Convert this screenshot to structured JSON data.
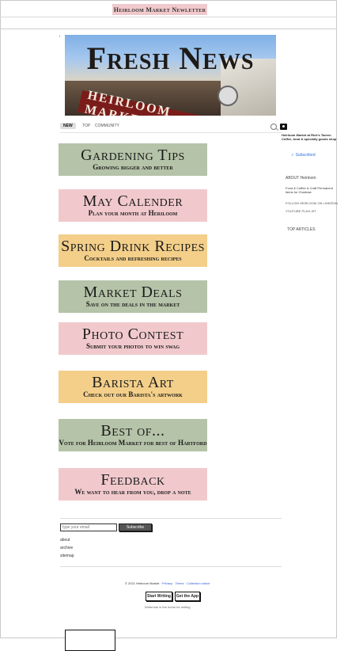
{
  "header": {
    "site_title": "Heirloom Market Newletter"
  },
  "hero": {
    "headline": "Fresh News",
    "sign_text": "HEIRLOOM MARKET",
    "mark": "'"
  },
  "nav": {
    "tabs": [
      "NEW",
      "TOP",
      "COMMUNITY"
    ],
    "active": "NEW"
  },
  "cards": [
    {
      "title": "Gardening Tips",
      "subtitle": "Growing bigger and better",
      "color": "#b5c3a8"
    },
    {
      "title": "May Calender",
      "subtitle": "Plan your month at Heriloom",
      "color": "#f1c9cc"
    },
    {
      "title": "Spring Drink Recipes",
      "subtitle": "Cocktails and refreshing recipes",
      "color": "#f3cf8a"
    },
    {
      "title": "Market Deals",
      "subtitle": "Save on the deals in the market",
      "color": "#b5c3a8"
    },
    {
      "title": "Photo Contest",
      "subtitle": "Submit your photos to win swag",
      "color": "#f1c9cc"
    },
    {
      "title": "Barista Art",
      "subtitle": "Check out our Barista's artwork",
      "color": "#f3cf8a"
    },
    {
      "title": "Best of...",
      "subtitle": "Vote for Heirloom Market for best of Hartford",
      "color": "#b5c3a8"
    },
    {
      "title": "Feedback",
      "subtitle": "We want to hear from you, drop a note",
      "color": "#f1c9cc"
    }
  ],
  "sidebar": {
    "blurb": "Heirloom Market at Rick's Tavern Coffee, food & specialty goods shop",
    "subscribed": "✓ Subscribed",
    "about_heading": "ABOUT Heirloom",
    "about_text": "Food & Coffee & Craft Permanent items for Chartraw",
    "follow_text": "FOLLOW HEIRLOOM ON LINKEDIN",
    "youtube_text": "YOUTUBE PLAYLIST",
    "top_articles": "TOP ARTICLES"
  },
  "footer": {
    "email_placeholder": "type your email",
    "subscribe_label": "Subscribe",
    "links": [
      "about",
      "archive",
      "sitemap"
    ],
    "legal_prefix": "© 2021 Heirloom Market · ",
    "legal_links": "Privacy · Terms · Collection notice",
    "start_writing": "Start Writing",
    "get_app": "Get the App",
    "tagline": "Writerhub is the home for writing"
  },
  "colors": {
    "sage": "#b5c3a8",
    "pink": "#f1c9cc",
    "gold": "#f3cf8a"
  }
}
